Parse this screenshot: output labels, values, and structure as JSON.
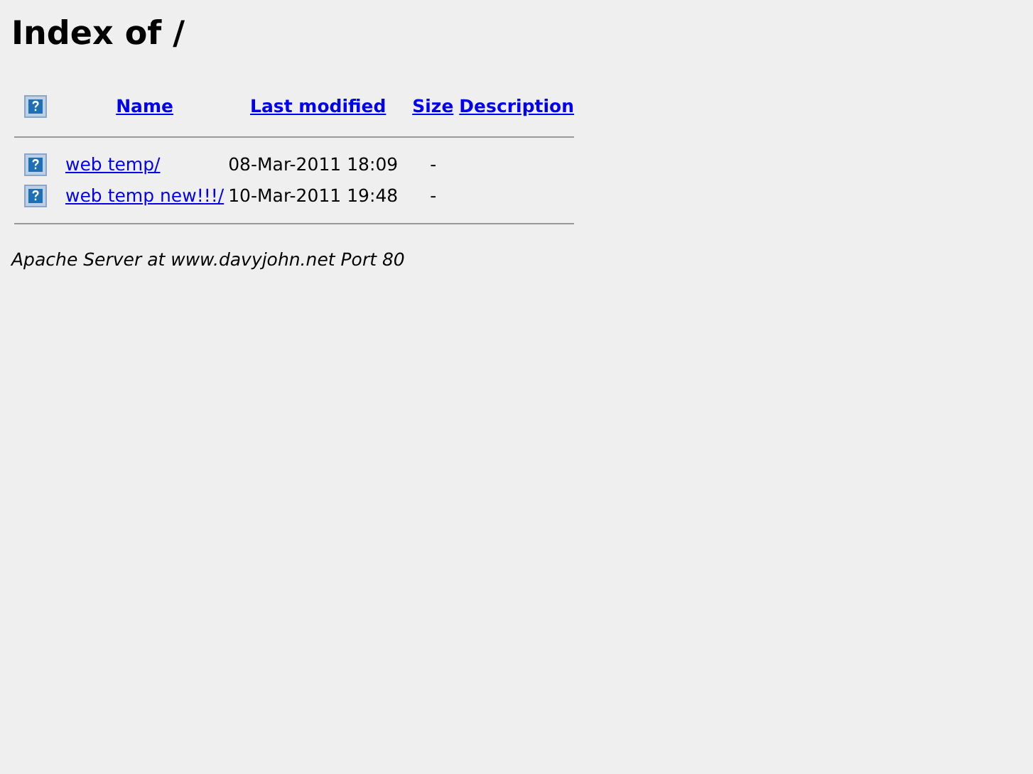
{
  "title": "Index of /",
  "columns": [
    "Name",
    "Last modified",
    "Size",
    "Description"
  ],
  "rows": [
    {
      "name": "web temp/",
      "modified": "08-Mar-2011 18:09",
      "size": "-"
    },
    {
      "name": "web temp new!!!/",
      "modified": "10-Mar-2011 19:48",
      "size": "-"
    }
  ],
  "footer": "Apache Server at www.davyjohn.net Port 80"
}
